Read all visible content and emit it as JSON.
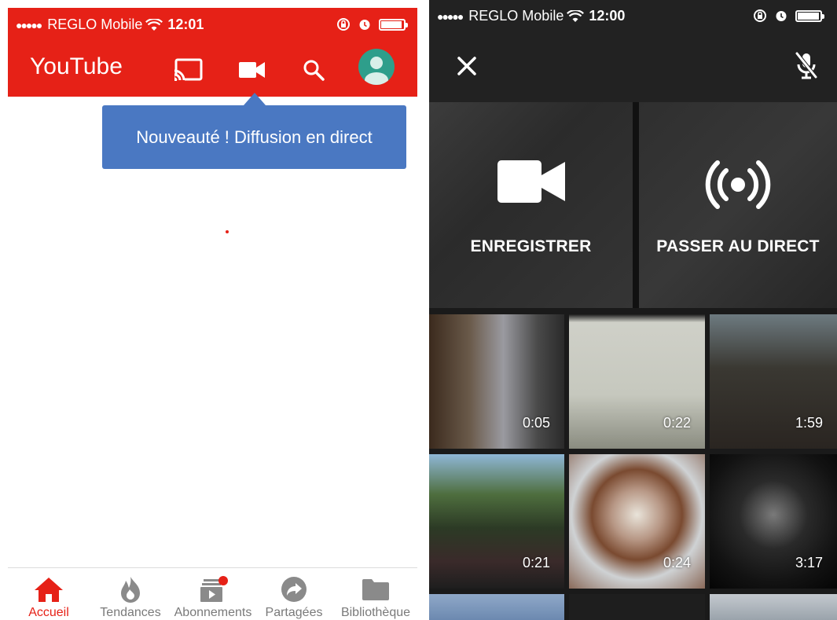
{
  "left_screen": {
    "status": {
      "signal_dots": "●●●●●",
      "carrier": "REGLO Mobile",
      "time": "12:01",
      "battery_level": 0.85
    },
    "app_title": "YouTube",
    "tooltip": "Nouveauté ! Diffusion en direct",
    "nav": [
      {
        "label": "Accueil",
        "icon": "home-icon",
        "active": true
      },
      {
        "label": "Tendances",
        "icon": "flame-icon",
        "active": false
      },
      {
        "label": "Abonnements",
        "icon": "subscriptions-icon",
        "active": false
      },
      {
        "label": "Partagées",
        "icon": "share-icon",
        "active": false
      },
      {
        "label": "Bibliothèque",
        "icon": "folder-icon",
        "active": false
      }
    ]
  },
  "right_screen": {
    "status": {
      "signal_dots": "●●●●●",
      "carrier": "REGLO Mobile",
      "time": "12:00",
      "battery_level": 0.9
    },
    "modes": [
      {
        "label": "ENREGISTRER",
        "icon": "video-camera-icon"
      },
      {
        "label": "PASSER AU DIRECT",
        "icon": "live-broadcast-icon"
      }
    ],
    "videos": [
      {
        "duration": "0:05"
      },
      {
        "duration": "0:22"
      },
      {
        "duration": "1:59"
      },
      {
        "duration": "0:21"
      },
      {
        "duration": "0:24"
      },
      {
        "duration": "3:17"
      }
    ]
  },
  "colors": {
    "youtube_red": "#e62117",
    "tooltip_blue": "#4a78c2",
    "avatar_teal": "#2e9e8b",
    "nav_inactive": "#7a7a7a"
  }
}
